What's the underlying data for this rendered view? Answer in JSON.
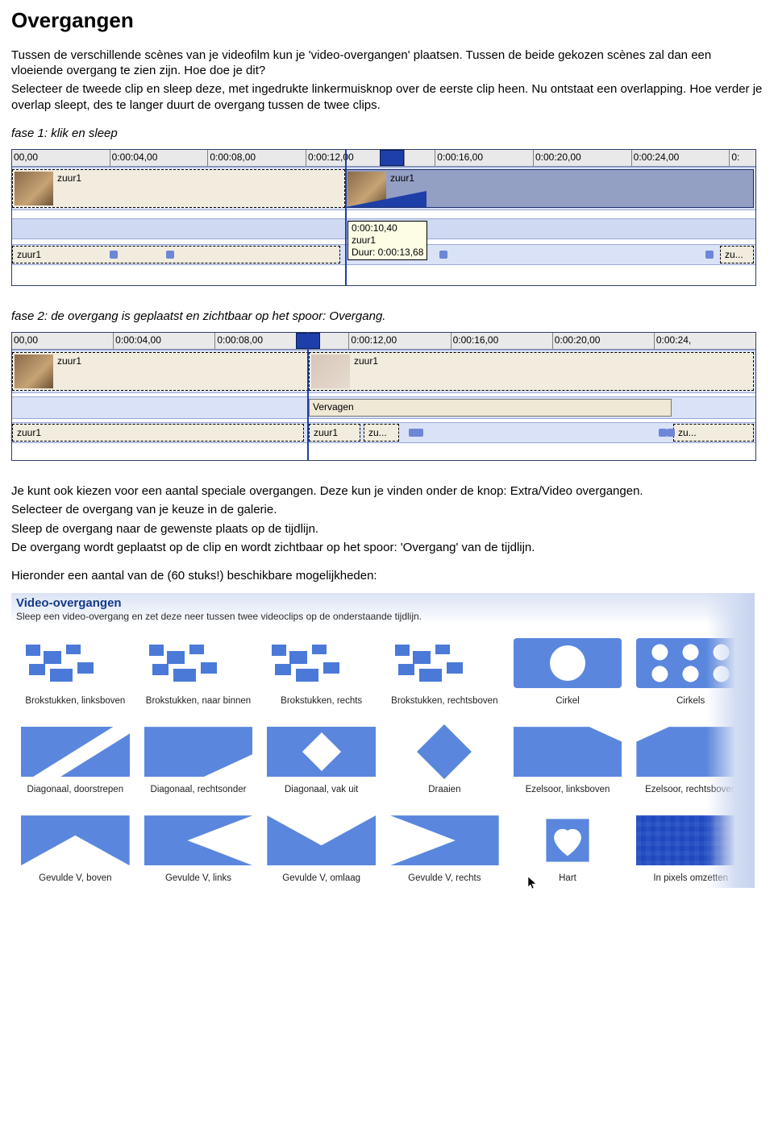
{
  "heading": "Overgangen",
  "intro": "Tussen de verschillende scènes van je videofilm kun je 'video-overgangen' plaatsen. Tussen de beide gekozen scènes zal dan een vloeiende overgang te zien zijn. Hoe doe je dit?",
  "intro2": "Selecteer de tweede clip en sleep deze, met ingedrukte linkermuisknop over de eerste clip heen. Nu ontstaat een overlapping. Hoe verder je overlap sleept, des te langer duurt de overgang tussen de twee clips.",
  "fase1": "fase 1: klik en sleep",
  "fase2": "fase 2: de overgang is geplaatst en zichtbaar op het spoor: Overgang.",
  "para3a": "Je kunt ook kiezen voor een aantal speciale overgangen. Deze kun je vinden onder de knop: Extra/Video overgangen.",
  "para3b": "Selecteer de overgang van je keuze in de galerie.",
  "para3c": "Sleep de overgang naar de gewenste plaats op de tijdlijn.",
  "para3d": "De overgang wordt geplaatst op de clip en wordt zichtbaar op het spoor: 'Overgang' van de tijdlijn.",
  "para4": "Hieronder een aantal van de (60 stuks!) beschikbare mogelijkheden:",
  "timeline1": {
    "ticks": [
      "00,00",
      "0:00:04,00",
      "0:00:08,00",
      "0:00:12,00",
      "",
      "0:00:16,00",
      "0:00:20,00",
      "0:00:24,00",
      "0:"
    ],
    "clip_left_label": "zuur1",
    "clip_right_label": "zuur1",
    "audio_left": "zuur1",
    "audio_right": "zu...",
    "tooltip_l1": "0:00:10,40",
    "tooltip_l2": "zuur1",
    "tooltip_l3": "Duur: 0:00:13,68"
  },
  "timeline2": {
    "ticks": [
      "00,00",
      "0:00:04,00",
      "0:00:08,00",
      "",
      "0:00:12,00",
      "0:00:16,00",
      "0:00:20,00",
      "0:00:24,"
    ],
    "clip_left_label": "zuur1",
    "clip_right_label": "zuur1",
    "trans_label": "Vervagen",
    "audio_left": "zuur1",
    "audio_mid1": "zuur1",
    "audio_mid2": "zu...",
    "audio_right": "zu..."
  },
  "gallery": {
    "title": "Video-overgangen",
    "subtitle": "Sleep een video-overgang en zet deze neer tussen twee videoclips op de onderstaande tijdlijn.",
    "items": [
      {
        "label": "Brokstukken, linksboven"
      },
      {
        "label": "Brokstukken, naar binnen"
      },
      {
        "label": "Brokstukken, rechts"
      },
      {
        "label": "Brokstukken, rechtsboven"
      },
      {
        "label": "Cirkel"
      },
      {
        "label": "Cirkels"
      },
      {
        "label": "Diagonaal, doorstrepen"
      },
      {
        "label": "Diagonaal, rechtsonder"
      },
      {
        "label": "Diagonaal, vak uit"
      },
      {
        "label": "Draaien"
      },
      {
        "label": "Ezelsoor, linksboven"
      },
      {
        "label": "Ezelsoor, rechtsboven"
      },
      {
        "label": "Gevulde V, boven"
      },
      {
        "label": "Gevulde V, links"
      },
      {
        "label": "Gevulde V, omlaag"
      },
      {
        "label": "Gevulde V, rechts"
      },
      {
        "label": "Hart"
      },
      {
        "label": "In pixels omzetten"
      }
    ]
  }
}
